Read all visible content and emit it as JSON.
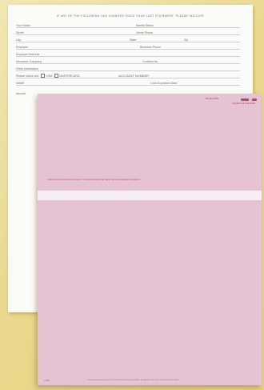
{
  "back_form": {
    "heading": "IF ANY OF THE FOLLOWING HAS CHANGED SINCE YOUR LAST STATEMENT, PLEASE INDICATE",
    "fields": {
      "your_name": "Your Name",
      "marital_status": "Marital Status",
      "street": "Street",
      "home_phone": "Home Phone",
      "city": "City",
      "state": "State",
      "zip": "Zip",
      "employer": "Employer",
      "business_phone": "Business Phone",
      "employer_address": "Employer Address",
      "insurance_company": "Insurance Company",
      "contract_no": "Contract No.",
      "other_information": "Other Information",
      "please_check_one": "Please check one",
      "visa": "VISA",
      "mastercard": "MASTERCARD",
      "account_number": "ACCOUNT NUMBER",
      "name": "NAME",
      "card_expiration_date": "Card Expiration Date",
      "amount": "Amount"
    }
  },
  "front_form": {
    "top_label_1": "BILLING DATE",
    "top_label_2": "PLEASE USE ONE FORM",
    "left_note": "PLEASE CHECK BOX IF ABOVE ADDRESS IS INCORRECT OR INSURANCE INFORMATION HAS CHANGED, AND INDICATE CHANGE(S) ON REVERSE SIDE",
    "form_code": "L1530",
    "footer_text": "PLEASE DETACH AND RETURN TOP PORTION WITH YOUR PAYMENT. RETAIN BOTTOM PORTION FOR YOUR RECORDS.",
    "colors": {
      "sheet": "#e5c3d3",
      "accent": "#b5466d"
    }
  }
}
